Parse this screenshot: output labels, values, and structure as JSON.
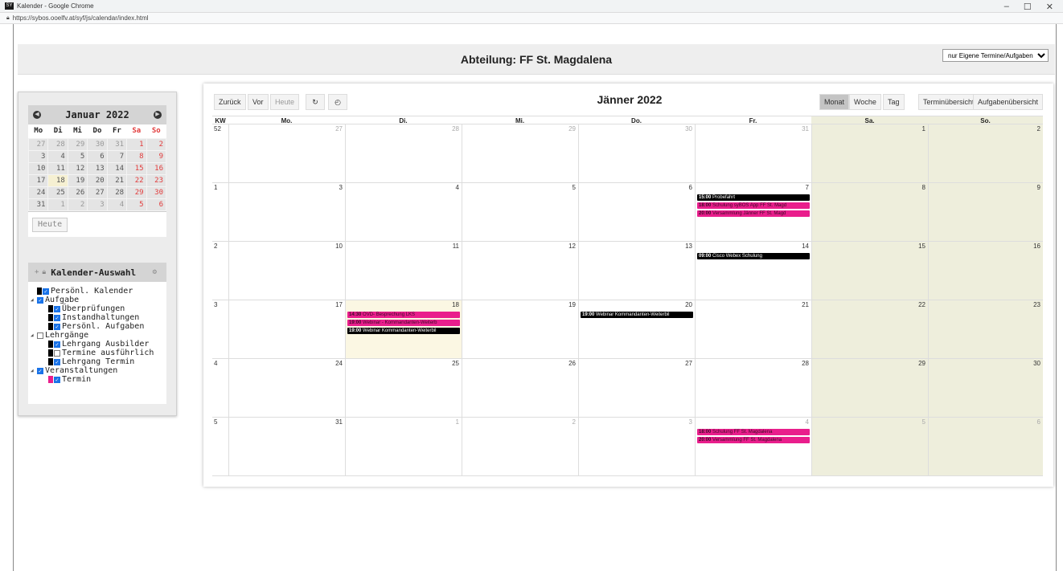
{
  "browser": {
    "window_title": "Kalender - Google Chrome",
    "favicon_text": "SY",
    "url": "https://sybos.ooelfv.at/syf/js/calendar/index.html",
    "controls": {
      "minimize": "–",
      "maximize": "☐",
      "close": "✕"
    }
  },
  "header": {
    "title": "Abteilung: FF St. Magdalena",
    "filter_selected": "nur Eigene Termine/Aufgaben"
  },
  "mini_calendar": {
    "title": "Januar 2022",
    "weekdays": [
      "Mo",
      "Di",
      "Mi",
      "Do",
      "Fr",
      "Sa",
      "So"
    ],
    "weeks": [
      [
        "27",
        "28",
        "29",
        "30",
        "31",
        "1",
        "2"
      ],
      [
        "3",
        "4",
        "5",
        "6",
        "7",
        "8",
        "9"
      ],
      [
        "10",
        "11",
        "12",
        "13",
        "14",
        "15",
        "16"
      ],
      [
        "17",
        "18",
        "19",
        "20",
        "21",
        "22",
        "23"
      ],
      [
        "24",
        "25",
        "26",
        "27",
        "28",
        "29",
        "30"
      ],
      [
        "31",
        "1",
        "2",
        "3",
        "4",
        "5",
        "6"
      ]
    ],
    "today_label": "Heute"
  },
  "calendar_select": {
    "title": "Kalender-Auswahl",
    "plus": "+",
    "items": [
      {
        "label": "Persönl. Kalender",
        "checked": true,
        "level": 0,
        "swatch": "#000000"
      },
      {
        "label": "Aufgabe",
        "checked": true,
        "level": 0,
        "expandable": true
      },
      {
        "label": "Überprüfungen",
        "checked": true,
        "level": 1,
        "swatch": "#000000"
      },
      {
        "label": "Instandhaltungen",
        "checked": true,
        "level": 1,
        "swatch": "#000000"
      },
      {
        "label": "Persönl. Aufgaben",
        "checked": true,
        "level": 1,
        "swatch": "#000000"
      },
      {
        "label": "Lehrgänge",
        "checked": false,
        "level": 0,
        "expandable": true
      },
      {
        "label": "Lehrgang Ausbilder",
        "checked": true,
        "level": 1,
        "swatch": "#000000"
      },
      {
        "label": "Termine ausführlich",
        "checked": false,
        "level": 1,
        "swatch": "#000000"
      },
      {
        "label": "Lehrgang Termin",
        "checked": true,
        "level": 1,
        "swatch": "#000000"
      },
      {
        "label": "Veranstaltungen",
        "checked": true,
        "level": 0,
        "expandable": true
      },
      {
        "label": "Termin",
        "checked": true,
        "level": 1,
        "swatch": "#e91e8c"
      }
    ]
  },
  "toolbar": {
    "prev": "Zurück",
    "next": "Vor",
    "today": "Heute",
    "refresh_icon": "↻",
    "clock_icon": "◴",
    "title": "Jänner 2022",
    "month": "Monat",
    "week": "Woche",
    "day": "Tag",
    "overview": "Terminübersicht",
    "tasks": "Aufgabenübersicht"
  },
  "grid": {
    "kw_label": "KW",
    "day_headers": [
      "Mo.",
      "Di.",
      "Mi.",
      "Do.",
      "Fr.",
      "Sa.",
      "So."
    ],
    "weeks": [
      {
        "kw": "52",
        "days": [
          "27",
          "28",
          "29",
          "30",
          "31",
          "1",
          "2"
        ]
      },
      {
        "kw": "1",
        "days": [
          "3",
          "4",
          "5",
          "6",
          "7",
          "8",
          "9"
        ]
      },
      {
        "kw": "2",
        "days": [
          "10",
          "11",
          "12",
          "13",
          "14",
          "15",
          "16"
        ]
      },
      {
        "kw": "3",
        "days": [
          "17",
          "18",
          "19",
          "20",
          "21",
          "22",
          "23"
        ]
      },
      {
        "kw": "4",
        "days": [
          "24",
          "25",
          "26",
          "27",
          "28",
          "29",
          "30"
        ]
      },
      {
        "kw": "5",
        "days": [
          "31",
          "1",
          "2",
          "3",
          "4",
          "5",
          "6"
        ]
      }
    ],
    "events": [
      {
        "week": 1,
        "day": 4,
        "slot": 0,
        "time": "15:00",
        "title": "Probefahrt",
        "color": "black"
      },
      {
        "week": 1,
        "day": 4,
        "slot": 1,
        "time": "18:00",
        "title": "Schulung syBOS App FF St. Magd",
        "color": "pink"
      },
      {
        "week": 1,
        "day": 4,
        "slot": 2,
        "time": "20:00",
        "title": "Versammlung Jänner FF St. Magd",
        "color": "pink"
      },
      {
        "week": 2,
        "day": 4,
        "slot": 0,
        "time": "09:00",
        "title": "Cisco Webex Schulung",
        "color": "black"
      },
      {
        "week": 3,
        "day": 1,
        "slot": 0,
        "time": "14:30",
        "title": "OVD- Besprechung LKS",
        "color": "pink"
      },
      {
        "week": 3,
        "day": 1,
        "slot": 1,
        "time": "19:00",
        "title": "Webinar - Kommandanten-Weiterb",
        "color": "pink"
      },
      {
        "week": 3,
        "day": 1,
        "slot": 2,
        "time": "19:00",
        "title": "Webinar Kommandanten-Weiterbil",
        "color": "black"
      },
      {
        "week": 3,
        "day": 3,
        "slot": 0,
        "time": "19:00",
        "title": "Webinar Kommandanten-Weiterbil",
        "color": "black"
      },
      {
        "week": 5,
        "day": 4,
        "slot": 0,
        "time": "18:00",
        "title": "Schulung FF St. Magdalena",
        "color": "pink"
      },
      {
        "week": 5,
        "day": 4,
        "slot": 1,
        "time": "20:00",
        "title": "Versammlung FF St. Magdalena",
        "color": "pink"
      }
    ]
  }
}
